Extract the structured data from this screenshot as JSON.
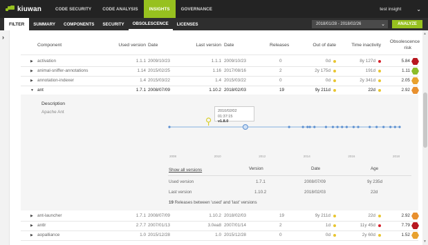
{
  "app": {
    "brand": "kiuwan"
  },
  "topnav": {
    "items": [
      {
        "label": "CODE SECURITY",
        "active": false
      },
      {
        "label": "CODE ANALYSIS",
        "active": false
      },
      {
        "label": "INSIGHTS",
        "active": true
      },
      {
        "label": "GOVERNANCE",
        "active": false
      }
    ],
    "user": "test insight",
    "user_chevron": "chevron-down-icon"
  },
  "subnav": {
    "filter_label": "FILTER",
    "tabs": [
      {
        "label": "SUMMARY",
        "active": false
      },
      {
        "label": "COMPONENTS",
        "active": false
      },
      {
        "label": "SECURITY",
        "active": false
      },
      {
        "label": "OBSOLESCENCE",
        "active": true
      },
      {
        "label": "LICENSES",
        "active": false
      }
    ],
    "date_range": "2018/01/28 - 2018/02/26",
    "analyze_label": "ANALYZE"
  },
  "rail": {
    "icon": "chevron-right-icon",
    "glyph": "›"
  },
  "table": {
    "headers": {
      "component": "Component",
      "used_version": "Used version",
      "used_date": "Date",
      "last_version": "Last version",
      "last_date": "Date",
      "releases": "Releases",
      "out_of_date": "Out of date",
      "time_inactivity": "Time inactivity",
      "obsolescence_risk_1": "Obsolescence",
      "obsolescence_risk_2": "risk"
    },
    "rows": [
      {
        "name": "activation",
        "used_version": "1.1.1",
        "used_date": "2009/10/23",
        "last_version": "1.1.1",
        "last_date": "2009/10/23",
        "releases": "0",
        "out_of_date": "0d",
        "ood_status": "#e8c530",
        "inactivity": "8y 127d",
        "inact_status": "#d6202a",
        "risk": "5.84",
        "risk_color": "#b8171f",
        "expanded": false
      },
      {
        "name": "animal-sniffer-annotations",
        "used_version": "1.14",
        "used_date": "2015/02/25",
        "last_version": "1.16",
        "last_date": "2017/08/16",
        "releases": "2",
        "out_of_date": "2y 175d",
        "ood_status": "#e8c530",
        "inactivity": "191d",
        "inact_status": "#e8c530",
        "risk": "1.11",
        "risk_color": "#8cbd2a",
        "expanded": false
      },
      {
        "name": "annotation-indexer",
        "used_version": "1.4",
        "used_date": "2015/03/22",
        "last_version": "1.4",
        "last_date": "2015/03/22",
        "releases": "0",
        "out_of_date": "0d",
        "ood_status": "#e8c530",
        "inactivity": "2y 341d",
        "inact_status": "#e8c530",
        "risk": "2.05",
        "risk_color": "#e8a12e",
        "expanded": false
      },
      {
        "name": "ant",
        "used_version": "1.7.1",
        "used_date": "2008/07/09",
        "last_version": "1.10.2",
        "last_date": "2018/02/03",
        "releases": "19",
        "out_of_date": "9y 211d",
        "ood_status": "#e8c530",
        "inactivity": "22d",
        "inact_status": "#e8c530",
        "risk": "2.92",
        "risk_color": "#e8902e",
        "expanded": true
      }
    ],
    "rows_after": [
      {
        "name": "ant-launcher",
        "used_version": "1.7.1",
        "used_date": "2008/07/09",
        "last_version": "1.10.2",
        "last_date": "2018/02/03",
        "releases": "19",
        "out_of_date": "9y 211d",
        "ood_status": "#e8c530",
        "inactivity": "22d",
        "inact_status": "#e8c530",
        "risk": "2.92",
        "risk_color": "#e8902e"
      },
      {
        "name": "antlr",
        "used_version": "2.7.7",
        "used_date": "2007/01/13",
        "last_version": "3.0ea8",
        "last_date": "2007/01/14",
        "releases": "2",
        "out_of_date": "1d",
        "ood_status": "#e8c530",
        "inactivity": "11y 45d",
        "inact_status": "#d6202a",
        "risk": "7.79",
        "risk_color": "#b8171f"
      },
      {
        "name": "aopalliance",
        "used_version": "1.0",
        "used_date": "2015/12/28",
        "last_version": "1.0",
        "last_date": "2015/12/28",
        "releases": "0",
        "out_of_date": "0d",
        "ood_status": "#e8c530",
        "inactivity": "2y 60d",
        "inact_status": "#e8c530",
        "risk": "1.52",
        "risk_color": "#e8a12e"
      }
    ]
  },
  "detail": {
    "description_title": "Description",
    "description_text": "Apache Ant",
    "tooltip_date": "2010/02/02 01:37:15",
    "tooltip_version": "v1.8.0",
    "axis_labels": [
      "2008",
      "2010",
      "2012",
      "2014",
      "2016",
      "2018"
    ],
    "timeline": {
      "release_ticks": [
        0.0,
        0.52,
        0.58,
        0.6,
        0.61,
        0.63,
        0.68,
        0.71,
        0.73,
        0.75,
        0.77,
        0.8,
        0.82,
        0.87,
        0.9,
        0.93,
        0.96,
        0.98,
        1.0
      ],
      "used_marker": 0.17,
      "highlight_marker": 0.33
    },
    "versions": {
      "show_all_link": "Show all versions",
      "head_version": "Version",
      "head_date": "Date",
      "head_age": "Age",
      "used_label": "Used version",
      "used_version": "1.7.1",
      "used_date": "2008/07/09",
      "used_age": "9y 235d",
      "last_label": "Last version",
      "last_version": "1.10.2",
      "last_date": "2018/02/03",
      "last_age": "22d",
      "releases_count": "19",
      "releases_between": "Releases between 'used' and 'last' versions"
    }
  }
}
